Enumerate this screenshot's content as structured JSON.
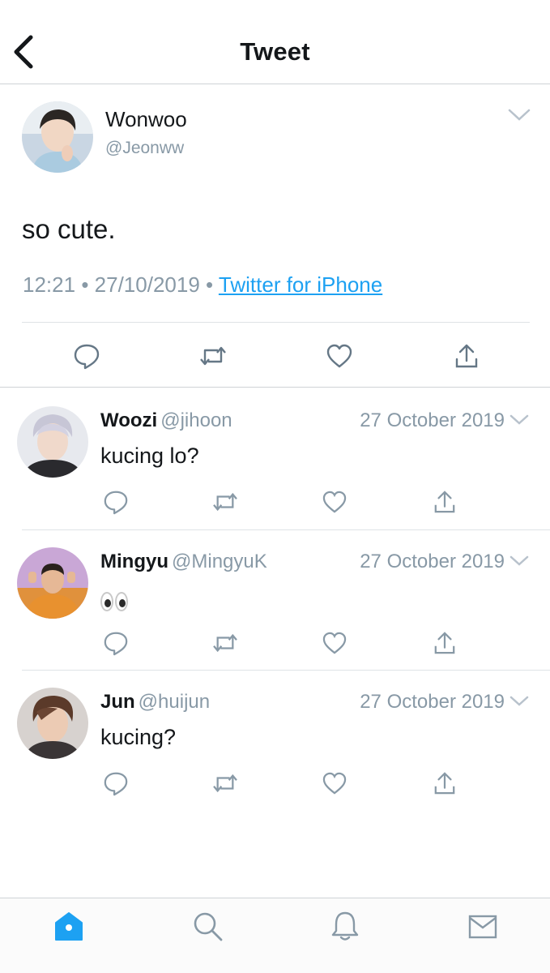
{
  "header": {
    "title": "Tweet",
    "back_icon": "chevron-left-icon"
  },
  "main_tweet": {
    "name": "Wonwoo",
    "handle": "@Jeonww",
    "text": "so cute.",
    "time": "12:21",
    "date": "27/10/2019",
    "separator": "•",
    "source": "Twitter for iPhone"
  },
  "replies": [
    {
      "name": "Woozi",
      "handle": "@jihoon",
      "date": "27 October 2019",
      "text": "kucing lo?"
    },
    {
      "name": "Mingyu",
      "handle": "@MingyuK",
      "date": "27 October 2019",
      "text": "",
      "emoji": "eyes"
    },
    {
      "name": "Jun",
      "handle": "@huijun",
      "date": "27 October 2019",
      "text": "kucing?"
    }
  ],
  "actions": [
    "reply-icon",
    "retweet-icon",
    "like-icon",
    "share-icon"
  ],
  "tabbar": {
    "tabs": [
      "home-icon",
      "search-icon",
      "notifications-icon",
      "messages-icon"
    ],
    "active": "home",
    "accent": "#1da1f2",
    "inactive": "#8899a6"
  },
  "colors": {
    "text": "#14171a",
    "muted": "#8899a6",
    "link": "#1da1f2",
    "border": "#cfd3d6"
  }
}
